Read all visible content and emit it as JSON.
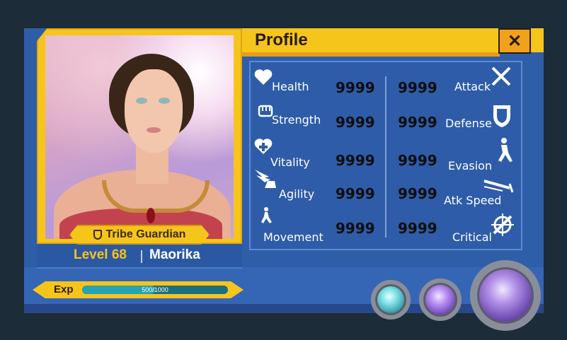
{
  "header": {
    "title": "Profile",
    "close_label": "✕"
  },
  "character": {
    "title": "Tribe Guardian",
    "level_label": "Level 68",
    "name": "Maorika"
  },
  "exp": {
    "label": "Exp",
    "current": 500,
    "max": 1000,
    "text": "500/1000",
    "fraction": 0.5
  },
  "stats_left": [
    {
      "label": "Health",
      "value": "9999",
      "icon": "heart-icon"
    },
    {
      "label": "Strength",
      "value": "9999",
      "icon": "fist-icon"
    },
    {
      "label": "Vitality",
      "value": "9999",
      "icon": "heart-plus-icon"
    },
    {
      "label": "Agility",
      "value": "9999",
      "icon": "winged-boot-icon"
    },
    {
      "label": "Movement",
      "value": "9999",
      "icon": "running-figure-icon"
    }
  ],
  "stats_right": [
    {
      "label": "Attack",
      "value": "9999",
      "icon": "crossed-swords-icon"
    },
    {
      "label": "Defense",
      "value": "9999",
      "icon": "shield-icon"
    },
    {
      "label": "Evasion",
      "value": "9999",
      "icon": "dodging-figure-icon"
    },
    {
      "label": "Atk Speed",
      "value": "9999",
      "icon": "speed-sword-icon"
    },
    {
      "label": "Critical",
      "value": "9999",
      "icon": "crosshair-sword-icon"
    }
  ],
  "orbs": [
    {
      "name": "cyan-orb",
      "color": "#7fe0e6"
    },
    {
      "name": "violet-orb",
      "color": "#b78ef2"
    },
    {
      "name": "purple-orb-large",
      "color": "#b593e8"
    }
  ],
  "colors": {
    "accent": "#f6c51c",
    "panel": "#2f5ea8",
    "background": "#1d2c39"
  }
}
